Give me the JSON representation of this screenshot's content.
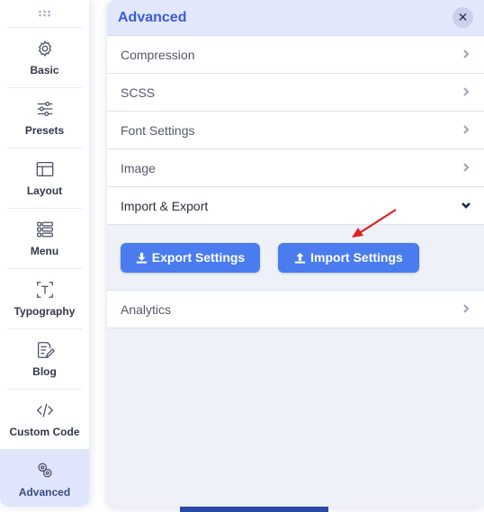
{
  "sidebar": {
    "items": [
      {
        "label": "Basic",
        "icon": "gear-icon"
      },
      {
        "label": "Presets",
        "icon": "sliders-icon"
      },
      {
        "label": "Layout",
        "icon": "layout-icon"
      },
      {
        "label": "Menu",
        "icon": "menu-icon"
      },
      {
        "label": "Typography",
        "icon": "typography-icon"
      },
      {
        "label": "Blog",
        "icon": "blog-icon"
      },
      {
        "label": "Custom Code",
        "icon": "code-icon"
      },
      {
        "label": "Advanced",
        "icon": "advanced-icon",
        "active": true
      }
    ]
  },
  "panel": {
    "title": "Advanced",
    "close_icon": "close-icon",
    "sections": [
      {
        "label": "Compression",
        "expanded": false
      },
      {
        "label": "SCSS",
        "expanded": false
      },
      {
        "label": "Font Settings",
        "expanded": false
      },
      {
        "label": "Image",
        "expanded": false
      },
      {
        "label": "Import & Export",
        "expanded": true
      },
      {
        "label": "Analytics",
        "expanded": false
      }
    ],
    "import_export": {
      "export_label": "Export Settings",
      "import_label": "Import Settings"
    }
  },
  "colors": {
    "accent": "#3a5bd9",
    "button": "#4a7cf0",
    "active_sidebar": "#dfe6fb",
    "annotation_arrow": "#e02020"
  }
}
